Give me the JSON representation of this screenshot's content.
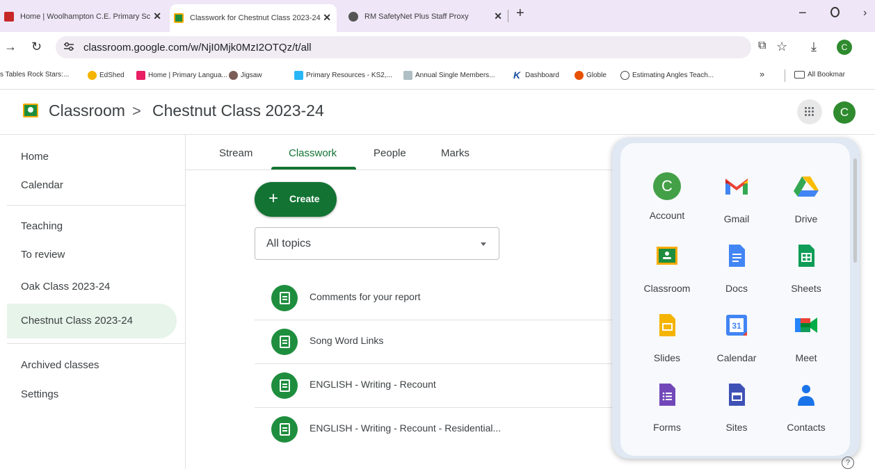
{
  "browser": {
    "tabs": [
      {
        "label": "Home | Woolhampton C.E. Primary Sc",
        "icon": "school-crest-icon"
      },
      {
        "label": "Classwork for Chestnut Class 2023-24",
        "icon": "classroom-icon"
      },
      {
        "label": "RM SafetyNet Plus Staff Proxy",
        "icon": "globe-icon"
      }
    ],
    "url": "classroom.google.com/w/NjI0Mjk0MzI2OTQz/t/all",
    "profile_initial": "C",
    "bookmarks": [
      "s Tables Rock Stars:...",
      "EdShed",
      "Home | Primary Langua...",
      "Jigsaw",
      "Primary Resources - KS2,...",
      "Annual Single Members...",
      "Dashboard",
      "Globle",
      "Estimating Angles Teach...",
      "»",
      "All Bookmar"
    ]
  },
  "header": {
    "app_name": "Classroom",
    "separator": ">",
    "class_name": "Chestnut Class 2023-24",
    "avatar_initial": "C"
  },
  "sidebar": {
    "items": [
      "Home",
      "Calendar",
      "Teaching",
      "To review",
      "Oak Class 2023-24",
      "Chestnut Class 2023-24",
      "Archived classes",
      "Settings"
    ]
  },
  "tabs": [
    "Stream",
    "Classwork",
    "People",
    "Marks"
  ],
  "main": {
    "create_label": "Create",
    "topic_filter": "All topics",
    "assignments": [
      "Comments for your report",
      "Song Word Links",
      "ENGLISH - Writing - Recount",
      "ENGLISH - Writing - Recount - Residential..."
    ]
  },
  "apps_panel": {
    "apps": [
      {
        "label": "Account",
        "icon": "account-avatar-icon"
      },
      {
        "label": "Gmail",
        "icon": "gmail-icon"
      },
      {
        "label": "Drive",
        "icon": "drive-icon"
      },
      {
        "label": "Classroom",
        "icon": "classroom-icon"
      },
      {
        "label": "Docs",
        "icon": "docs-icon"
      },
      {
        "label": "Sheets",
        "icon": "sheets-icon"
      },
      {
        "label": "Slides",
        "icon": "slides-icon"
      },
      {
        "label": "Calendar",
        "icon": "calendar-icon"
      },
      {
        "label": "Meet",
        "icon": "meet-icon"
      },
      {
        "label": "Forms",
        "icon": "forms-icon"
      },
      {
        "label": "Sites",
        "icon": "sites-icon"
      },
      {
        "label": "Contacts",
        "icon": "contacts-icon"
      }
    ],
    "account_initial": "C",
    "calendar_day": "31"
  },
  "colors": {
    "classroom_green": "#137333",
    "active_row": "#e6f4ea"
  }
}
